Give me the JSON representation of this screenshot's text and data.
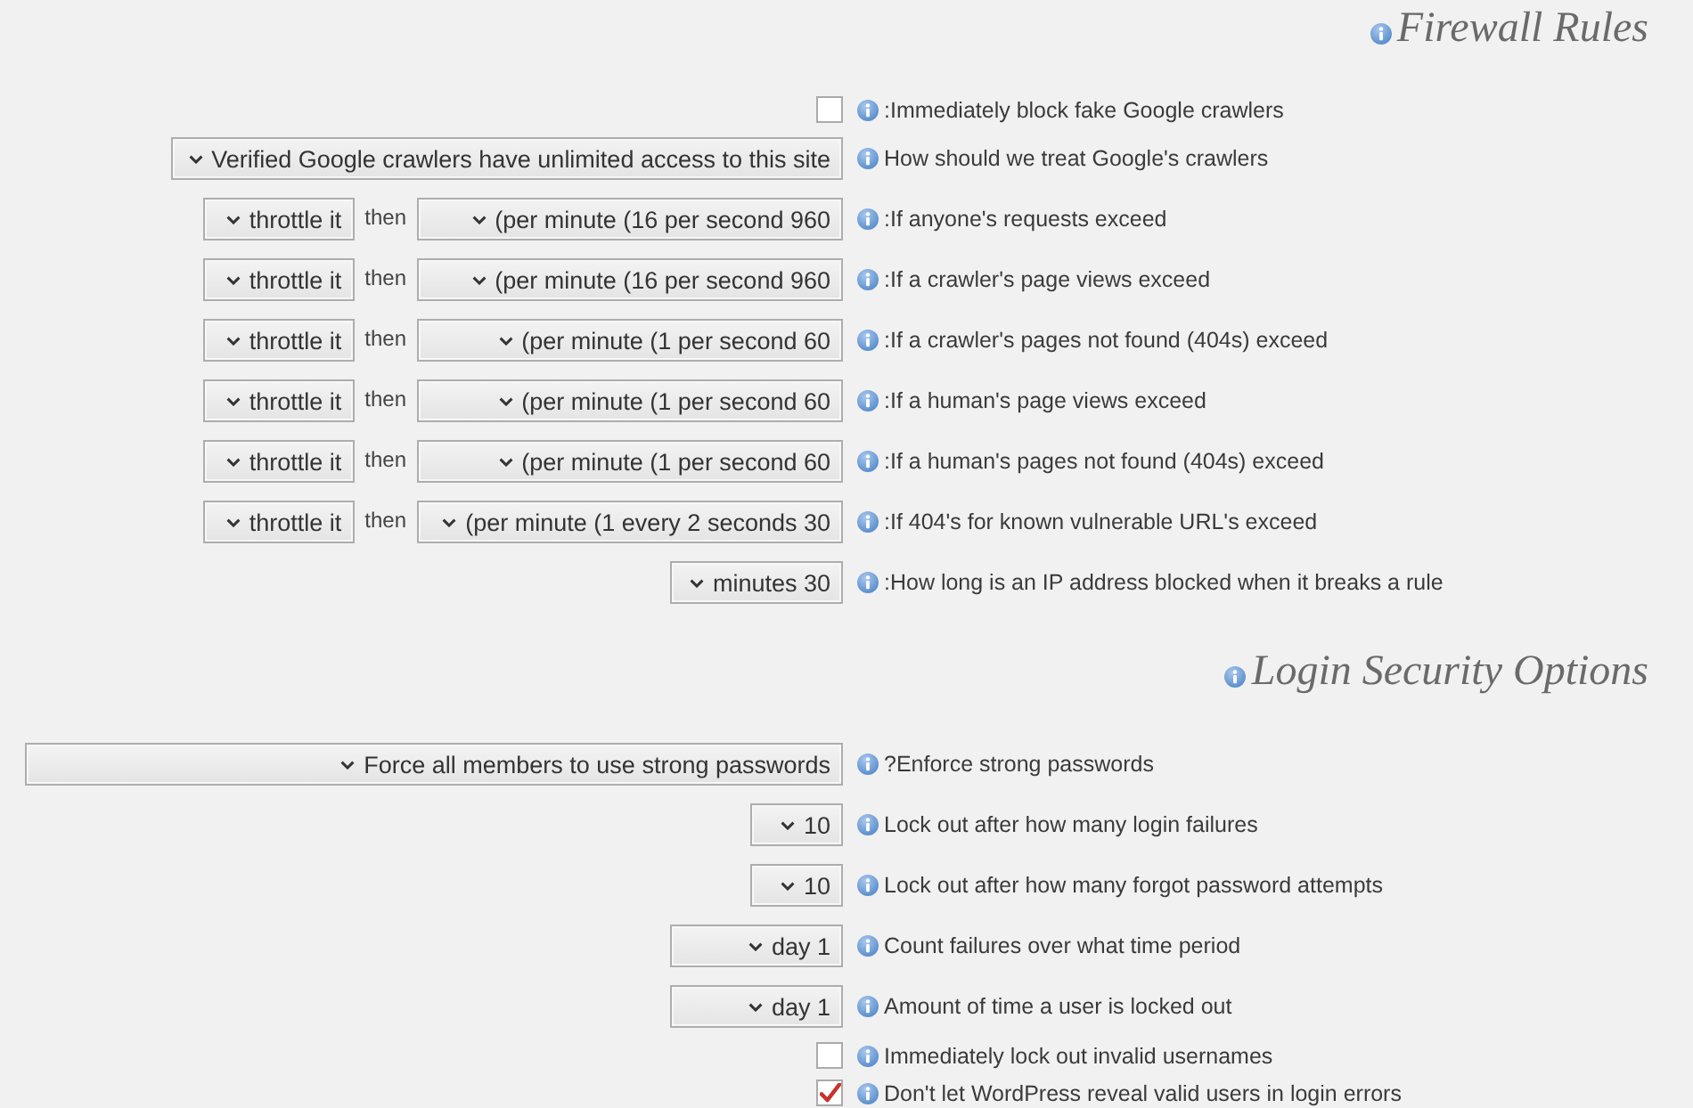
{
  "sections": [
    {
      "title": "Firewall Rules",
      "rows": [
        {
          "kind": "checkbox",
          "checked": false,
          "label": ":Immediately block fake Google crawlers"
        },
        {
          "kind": "select",
          "value": "Verified Google crawlers have unlimited access to this site",
          "label": "How should we treat Google's crawlers"
        },
        {
          "kind": "rule",
          "action": "throttle it",
          "joiner": "then",
          "rate": "(per minute (16 per second 960",
          "label": ":If anyone's requests exceed"
        },
        {
          "kind": "rule",
          "action": "throttle it",
          "joiner": "then",
          "rate": "(per minute (16 per second 960",
          "label": ":If a crawler's page views exceed"
        },
        {
          "kind": "rule",
          "action": "throttle it",
          "joiner": "then",
          "rate": "(per minute (1 per second 60",
          "label": ":If a crawler's pages not found (404s) exceed"
        },
        {
          "kind": "rule",
          "action": "throttle it",
          "joiner": "then",
          "rate": "(per minute (1 per second 60",
          "label": ":If a human's page views exceed"
        },
        {
          "kind": "rule",
          "action": "throttle it",
          "joiner": "then",
          "rate": "(per minute (1 per second 60",
          "label": ":If a human's pages not found (404s) exceed"
        },
        {
          "kind": "rule",
          "action": "throttle it",
          "joiner": "then",
          "rate": "(per minute (1 every 2 seconds 30",
          "label": ":If 404's for known vulnerable URL's exceed"
        },
        {
          "kind": "select",
          "value": "minutes 30",
          "label": ":How long is an IP address blocked when it breaks a rule"
        }
      ]
    },
    {
      "title": "Login Security Options",
      "rows": [
        {
          "kind": "select",
          "value": "Force all members to use strong passwords",
          "label": "?Enforce strong passwords"
        },
        {
          "kind": "select",
          "value": "10",
          "label": "Lock out after how many login failures"
        },
        {
          "kind": "select",
          "value": "10",
          "label": "Lock out after how many forgot password attempts"
        },
        {
          "kind": "select",
          "value": "day 1",
          "label": "Count failures over what time period"
        },
        {
          "kind": "select",
          "value": "day 1",
          "label": "Amount of time a user is locked out"
        },
        {
          "kind": "checkbox",
          "checked": false,
          "label": "Immediately lock out invalid usernames"
        },
        {
          "kind": "checkbox",
          "checked": true,
          "label": "Don't let WordPress reveal valid users in login errors"
        }
      ]
    }
  ]
}
